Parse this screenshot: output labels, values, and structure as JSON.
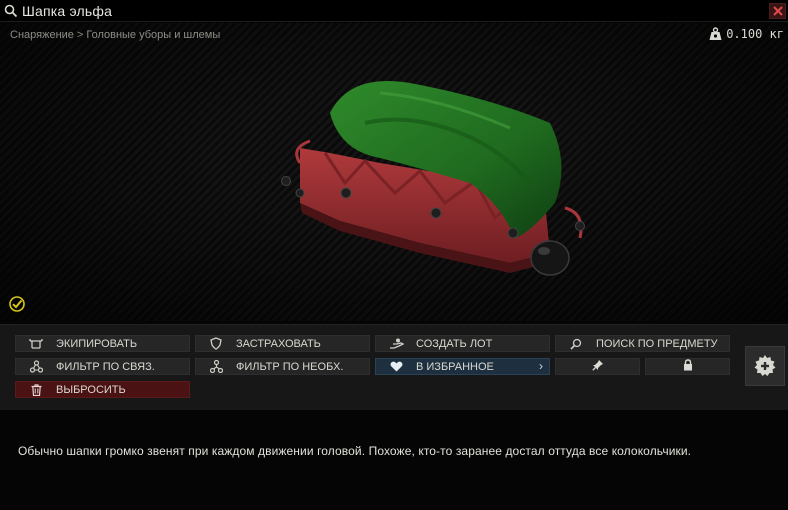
{
  "window": {
    "title": "Шапка эльфа"
  },
  "breadcrumb": {
    "parts": [
      "Снаряжение",
      ">",
      "Головные уборы и шлемы"
    ]
  },
  "item": {
    "weight": "0.100 кг"
  },
  "actions": {
    "equip": "ЭКИПИРОВАТЬ",
    "insure": "ЗАСТРАХОВАТЬ",
    "create_offer": "СОЗДАТЬ ЛОТ",
    "search_item": "ПОИСК ПО ПРЕДМЕТУ",
    "filter_linked": "ФИЛЬТР ПО СВЯЗ.",
    "filter_required": "ФИЛЬТР ПО НЕОБХ.",
    "favorite": "В ИЗБРАННОЕ",
    "favorite_chevron": "›",
    "discard": "ВЫБРОСИТЬ"
  },
  "description": "Обычно шапки громко звенят при каждом движении головой. Похоже, кто-то заранее достал оттуда все колокольчики.",
  "icons": {
    "title": "search-icon",
    "close": "close-icon",
    "weight": "weight-icon",
    "check": "check-badge-icon",
    "equip": "equip-icon",
    "insure": "shield-icon",
    "create_offer": "offer-hand-icon",
    "search_item": "magnifier-icon",
    "filter_linked": "linked-filter-icon",
    "filter_required": "required-filter-icon",
    "favorite": "heart-icon",
    "pin": "pin-icon",
    "lock": "lock-icon",
    "discard": "trash-icon",
    "side": "add-gear-icon"
  },
  "colors": {
    "accent_fav": "#1e3040",
    "danger": "#4a1212",
    "check": "#d7c51a"
  }
}
